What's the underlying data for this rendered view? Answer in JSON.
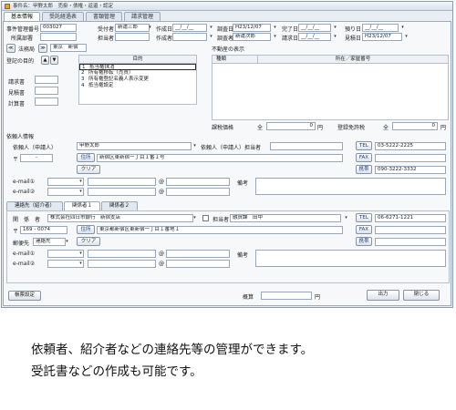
{
  "window": {
    "title": "事件名：甲野太郎　売掛・債権・返還・認定"
  },
  "tabs": [
    "基本情報",
    "受託経過表",
    "書類管理",
    "請求管理"
  ],
  "header": {
    "case_no_label": "事件管理番号",
    "case_no": "003027",
    "dept_label": "所属部署",
    "receiver_label": "受付者",
    "receiver": "新運三郎",
    "manager_label": "担当者",
    "created_label": "作成日",
    "created": "__/__/__",
    "creator_label": "作成者",
    "survey_date_label": "調査日",
    "survey_date": "H23/12/07",
    "surveyor_label": "調査者",
    "surveyor": "新運次郎",
    "complete_label": "完了日",
    "complete": "__/__/__",
    "claim_date_label": "請求日",
    "claim_date": "__/__/__",
    "deposit_label": "預り日",
    "deposit": "__/__/__",
    "estimate_label": "見積日",
    "estimate": "H23/12/07"
  },
  "left": {
    "purpose_label": "登記の目的",
    "office_label": "法務局",
    "office_value": "東京　新宿",
    "request_label": "請求書",
    "estimate_label": "見積書",
    "calc_label": "計算書"
  },
  "purpose_list": {
    "header": "目的",
    "items": [
      "抵当権抹消",
      "所有権移転（売買）",
      "所有権登記名義人表示変更",
      "抵当権設定"
    ]
  },
  "property": {
    "section_label": "不動産の表示",
    "col_type": "種類",
    "col_address": "所在／家屋番号",
    "tax_label": "課税価格",
    "tax_total_label": "全",
    "tax_value": "0",
    "tax_unit": "円",
    "license_label": "登録免許税",
    "license_total_label": "全",
    "license_value": "0",
    "license_unit": "円"
  },
  "requester": {
    "section_label": "依頼人情報",
    "name_label": "依頼人（申請人）",
    "name": "甲野太郎",
    "contact_label": "依頼人（申請人）担当者",
    "zip_label": "〒",
    "zip": "-",
    "address_btn": "住所",
    "address": "新宿区東新宿一丁目１番１号",
    "clear_btn": "クリア",
    "email1_label": "e-mail①",
    "email2_label": "e-mail②",
    "at": "@",
    "note_label": "備考",
    "tel_btn": "TEL",
    "tel": "03-5222-2225",
    "fax_btn": "FAX",
    "fax": "",
    "mobile_btn": "携帯",
    "mobile": "090-3222-3332"
  },
  "contacts": {
    "tabs": [
      "連絡先（紹介者）",
      "関係者１",
      "関係者２"
    ],
    "party_label": "関　係　者",
    "party": "株式会社四日市銀行　新宿支店",
    "contact_label": "担当者",
    "contact": "融資課　田中",
    "zip_label": "〒",
    "zip": "169 - 0074",
    "address_btn": "住所",
    "address": "東京都新宿区東新宿一丁目１番地１",
    "sendto_label": "郵便先",
    "sendto": "連絡先",
    "clear_btn": "クリア",
    "email1_label": "e-mail①",
    "email2_label": "e-mail②",
    "at": "@",
    "note_label": "備考",
    "tel_btn": "TEL",
    "tel": "06-6271-1221",
    "fax_btn": "FAX",
    "fax": "",
    "mobile_btn": "携帯",
    "mobile": ""
  },
  "footer": {
    "settings_btn": "帳票設定",
    "summary_label": "概算",
    "summary_unit": "円",
    "output_btn": "出力",
    "close_btn": "閉じる"
  },
  "caption": {
    "line1": "依頼者、紹介者などの連絡先等の管理ができます。",
    "line2": "受託書などの作成も可能です。"
  }
}
